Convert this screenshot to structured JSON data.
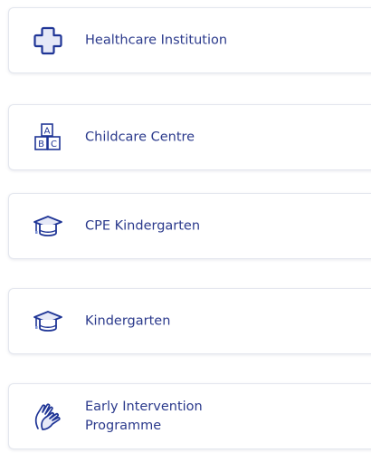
{
  "items": [
    {
      "label": "Healthcare Institution",
      "icon": "medical-cross-icon"
    },
    {
      "label": "Childcare Centre",
      "icon": "abc-blocks-icon"
    },
    {
      "label": "CPE Kindergarten",
      "icon": "graduation-cap-icon"
    },
    {
      "label": "Kindergarten",
      "icon": "graduation-cap-icon"
    },
    {
      "label": "Early Intervention\nProgramme",
      "icon": "hands-icon"
    }
  ],
  "colors": {
    "text": "#2b3a8c",
    "icon": "#1f3596",
    "icon_fill": "#e6e9f7",
    "border": "#e3e6ee"
  }
}
